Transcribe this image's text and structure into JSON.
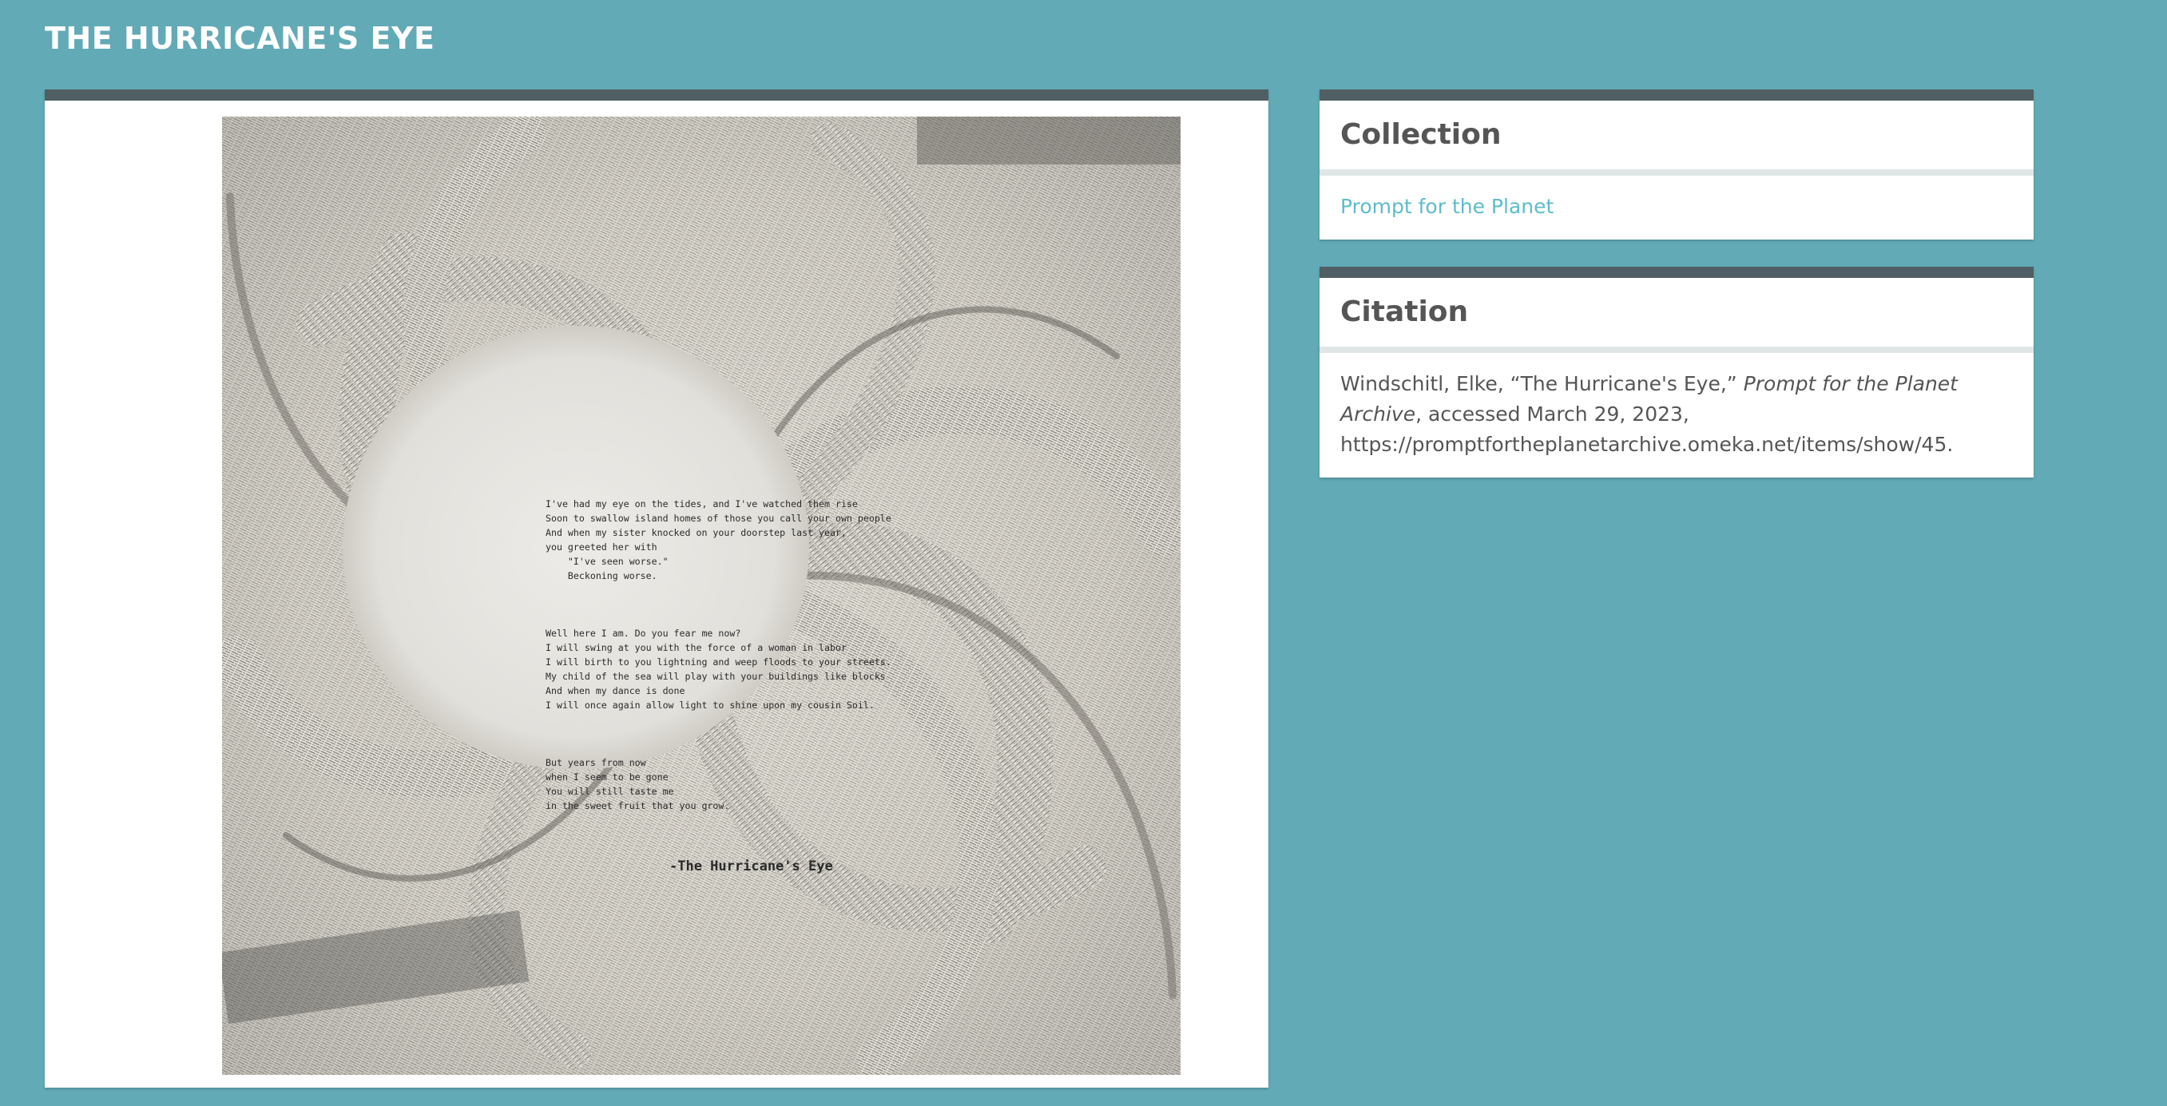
{
  "site": {
    "title": "THE HURRICANE'S EYE"
  },
  "artwork": {
    "poem": {
      "stanzas": [
        [
          "I've had my eye on the tides, and I've watched them rise",
          "Soon to swallow island homes of those you call your own people",
          "And when my sister knocked on your doorstep last year,",
          "you greeted her with",
          "    \"I've seen worse.\"",
          "    Beckoning worse."
        ],
        [
          "Well here I am. Do you fear me now?",
          "I will swing at you with the force of a woman in labor",
          "I will birth to you lightning and weep floods to your streets.",
          "My child of the sea will play with your buildings like blocks",
          "And when my dance is done",
          "I will once again allow light to shine upon my cousin Soil."
        ],
        [
          "But years from now",
          "when I seem to be gone",
          "You will still taste me",
          "in the sweet fruit that you grow."
        ]
      ],
      "signature": "-The Hurricane's Eye"
    }
  },
  "collection": {
    "heading": "Collection",
    "link_text": "Prompt for the Planet"
  },
  "citation": {
    "heading": "Citation",
    "prefix": "Windschitl, Elke, “The Hurricane's Eye,” ",
    "source": "Prompt for the Planet Archive",
    "line2": ", accessed March 29, 2023,",
    "url": "https://promptfortheplanetarchive.omeka.net/items/show/45."
  },
  "colors": {
    "background": "#62aab6",
    "panel_bar": "#4f5f63",
    "link": "#5dbccb"
  }
}
